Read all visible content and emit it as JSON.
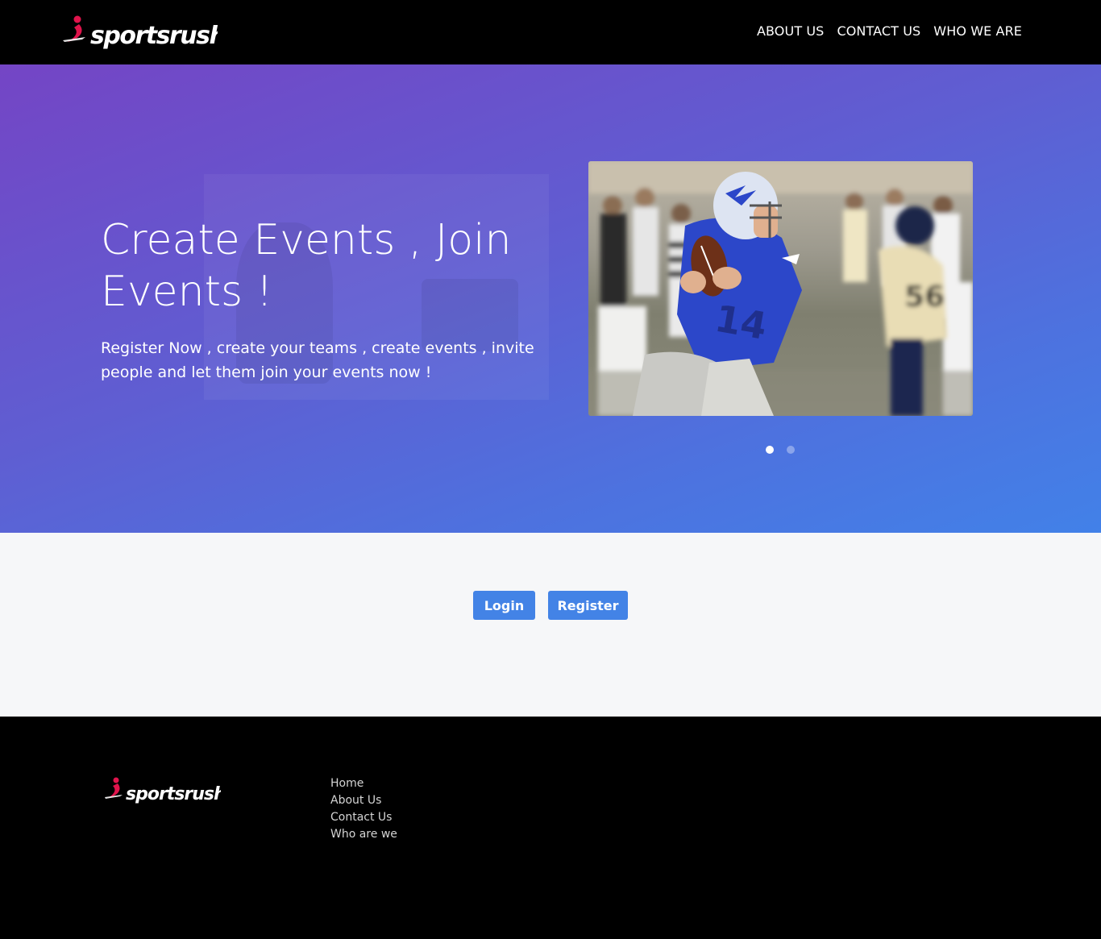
{
  "brand": {
    "name": "sportsrush",
    "accent_color": "#e0144c",
    "logo_icon": "running-figure-icon"
  },
  "nav": {
    "links": [
      {
        "label": "ABOUT US"
      },
      {
        "label": "CONTACT US"
      },
      {
        "label": "WHO WE ARE"
      }
    ]
  },
  "hero": {
    "title": "Create Events , Join Events !",
    "subtitle": "Register Now , create your teams , create events , invite people and let them join your events now !",
    "carousel": {
      "slide_count": 2,
      "active_slide": 1,
      "image": "football-quarterback-photo"
    },
    "gradient": [
      "#7445c5",
      "#4281e8"
    ]
  },
  "actions": {
    "login_label": "Login",
    "register_label": "Register",
    "button_color": "#4383e6"
  },
  "footer": {
    "links": [
      {
        "label": "Home"
      },
      {
        "label": "About Us"
      },
      {
        "label": "Contact Us"
      },
      {
        "label": "Who are we"
      }
    ]
  }
}
